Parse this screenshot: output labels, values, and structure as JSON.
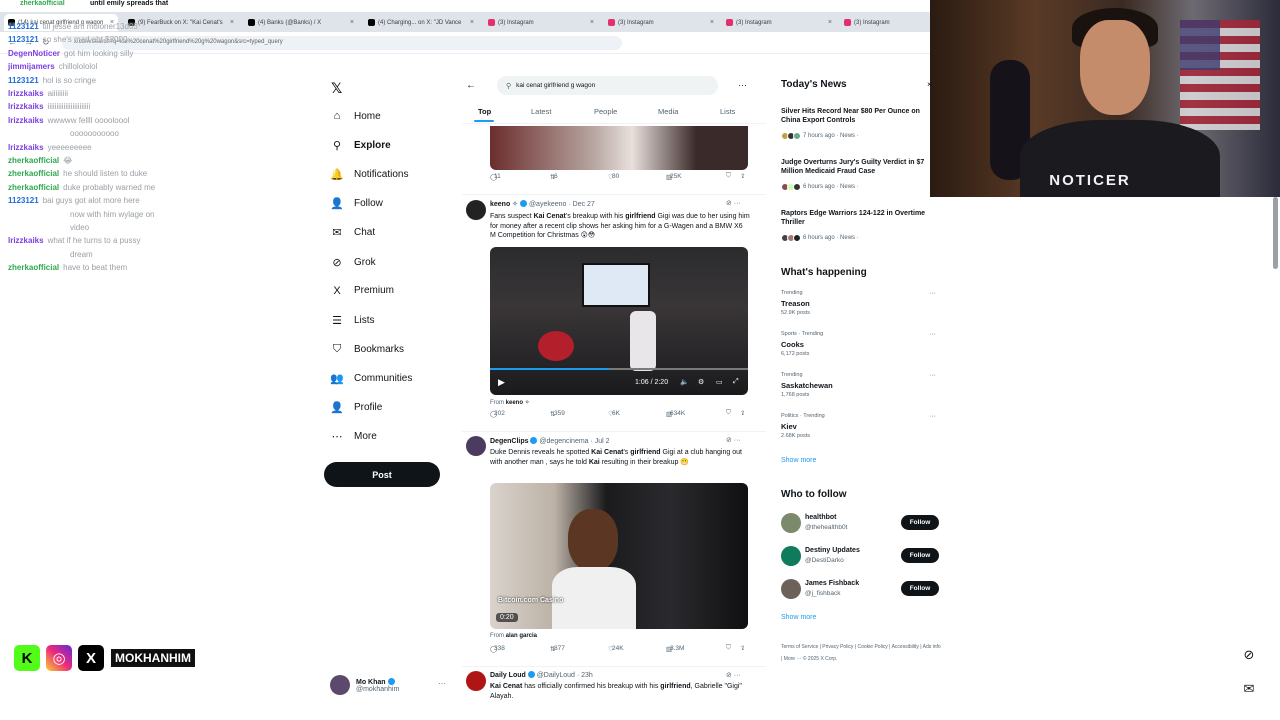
{
  "stream_title": "until emily spreads that",
  "stream_username": "zherkaofficial",
  "browser": {
    "tabs": [
      {
        "label": "(14) kai cenat girlfriend g wagon",
        "icon": "x-icon",
        "active": true
      },
      {
        "label": "(9) FearBuck on X: \"Kai Cenat's",
        "icon": "x-icon"
      },
      {
        "label": "(4) Banks (@Banks) / X",
        "icon": "x-icon"
      },
      {
        "label": "(4) Charging... on X: \"JD Vance",
        "icon": "x-icon"
      },
      {
        "label": "(3) Instagram",
        "icon": "instagram-icon"
      },
      {
        "label": "(3) Instagram",
        "icon": "instagram-icon"
      },
      {
        "label": "(3) Instagram",
        "icon": "instagram-icon"
      },
      {
        "label": "(3) Instagram",
        "icon": "instagram-icon"
      }
    ],
    "url": "x.com/search?q=kai%20cenat%20girlfriend%20g%20wagon&src=typed_query"
  },
  "chat": [
    {
      "user": "1123121",
      "color": "#1e6fd9",
      "msg": "till jesse am moloner13d03"
    },
    {
      "user": "1123121",
      "color": "#1e6fd9",
      "msg": "so she's mad abt $2000"
    },
    {
      "user": "DegenNoticer",
      "color": "#7b3fe4",
      "msg": "got him looking silly"
    },
    {
      "user": "jimmijamers",
      "color": "#7b3fe4",
      "msg": "chillolololol"
    },
    {
      "user": "1123121",
      "color": "#1e6fd9",
      "msg": "hol is so cringe"
    },
    {
      "user": "lrizzkaiks",
      "color": "#7b3fe4",
      "msg": "aiiiiiiiii"
    },
    {
      "user": "lrizzkaiks",
      "color": "#7b3fe4",
      "msg": "iiiiiiiiiiiiiiiiiiiiiiii"
    },
    {
      "user": "lrizzkaiks",
      "color": "#7b3fe4",
      "msg": "wwwww fellll ooooloool"
    },
    {
      "user": "",
      "color": "#7b3fe4",
      "msg": "ooooooooooo"
    },
    {
      "user": "lrizzkaiks",
      "color": "#7b3fe4",
      "msg": "yeeeeeeeee"
    },
    {
      "user": "zherkaofficial",
      "color": "#2fa84f",
      "msg": "😂"
    },
    {
      "user": "zherkaofficial",
      "color": "#2fa84f",
      "msg": "he should listen to duke"
    },
    {
      "user": "zherkaofficial",
      "color": "#2fa84f",
      "msg": "duke probably warned me"
    },
    {
      "user": "1123121",
      "color": "#1e6fd9",
      "msg": "bai guys got alot more here"
    },
    {
      "user": "",
      "color": "#1e6fd9",
      "msg": "now with him wylage on"
    },
    {
      "user": "",
      "color": "#1e6fd9",
      "msg": "video"
    },
    {
      "user": "lrizzkaiks",
      "color": "#7b3fe4",
      "msg": "what if he turns to a pussy"
    },
    {
      "user": "",
      "color": "#7b3fe4",
      "msg": "dream"
    },
    {
      "user": "zherkaofficial",
      "color": "#2fa84f",
      "msg": "have to beat them"
    }
  ],
  "socials": {
    "handle": "MOKHANHIM"
  },
  "webcam": {
    "shirt_text": "NOTICER"
  },
  "x_nav": {
    "items": [
      {
        "label": "Home",
        "icon": "home-icon",
        "glyph": "⌂"
      },
      {
        "label": "Explore",
        "icon": "search-icon",
        "glyph": "⚲",
        "bold": true
      },
      {
        "label": "Notifications",
        "icon": "bell-icon",
        "glyph": "🔔"
      },
      {
        "label": "Follow",
        "icon": "person-add-icon",
        "glyph": "👤"
      },
      {
        "label": "Chat",
        "icon": "chat-icon",
        "glyph": "✉"
      },
      {
        "label": "Grok",
        "icon": "grok-icon",
        "glyph": "⊘"
      },
      {
        "label": "Premium",
        "icon": "x-premium-icon",
        "glyph": "X"
      },
      {
        "label": "Lists",
        "icon": "list-icon",
        "glyph": "☰"
      },
      {
        "label": "Bookmarks",
        "icon": "bookmark-icon",
        "glyph": "⛉"
      },
      {
        "label": "Communities",
        "icon": "communities-icon",
        "glyph": "👥"
      },
      {
        "label": "Profile",
        "icon": "profile-icon",
        "glyph": "👤"
      },
      {
        "label": "More",
        "icon": "more-icon",
        "glyph": "⋯"
      }
    ],
    "post_label": "Post",
    "account": {
      "name": "Mo Khan",
      "handle": "@mokhanhim"
    }
  },
  "search": {
    "query": "kai cenat girlfriend g wagon",
    "tabs": [
      "Top",
      "Latest",
      "People",
      "Media",
      "Lists"
    ],
    "active_tab": "Top"
  },
  "posts": [
    {
      "stats": {
        "replies": "11",
        "reposts": "6",
        "likes": "80",
        "views": "25K"
      }
    },
    {
      "name": "keeno ✧",
      "handle": "@ayekeeno · Dec 27",
      "text_parts": [
        "Fans suspect ",
        "Kai Cenat",
        "'s breakup with his ",
        "girlfriend",
        " Gigi was due to her using him for money after a recent clip shows her asking him for a G-Wagen and a BMW X6 M Competition for Christmas 😲😳"
      ],
      "video_time": "1:06 / 2:20",
      "from_label": "From",
      "from": "keeno ✧",
      "stats": {
        "replies": "202",
        "reposts": "359",
        "likes": "6K",
        "views": "634K"
      }
    },
    {
      "name": "DegenClips",
      "handle": "@degencinema · Jul 2",
      "text_parts": [
        "Duke Dennis reveals he spotted ",
        "Kai Cenat",
        "'s ",
        "girlfriend",
        " Gigi at a club hanging out with another man , says he told ",
        "Kai",
        " resulting in their breakup 😬"
      ],
      "video_time": "0:20",
      "watermark": "Bitcoin.com Casino",
      "from_label": "From",
      "from": "alan garcia",
      "stats": {
        "replies": "338",
        "reposts": "877",
        "likes": "24K",
        "views": "3.3M"
      }
    },
    {
      "name": "Daily Loud",
      "handle": "@DailyLoud · 23h",
      "text_parts": [
        "Kai Cenat",
        " has officially confirmed his breakup with his ",
        "girlfriend",
        ", Gabrielle \"Gigi\" Alayah."
      ]
    }
  ],
  "today_news": {
    "title": "Today's News",
    "items": [
      {
        "title": "Silver Hits Record Near $80 Per Ounce on China Export Controls",
        "meta": "7 hours ago · News ·"
      },
      {
        "title": "Judge Overturns Jury's Guilty Verdict in $7 Million Medicaid Fraud Case",
        "meta": "6 hours ago · News ·"
      },
      {
        "title": "Raptors Edge Warriors 124-122 in Overtime Thriller",
        "meta": "6 hours ago · News ·"
      }
    ]
  },
  "happening": {
    "title": "What's happening",
    "items": [
      {
        "context": "Trending",
        "name": "Treason",
        "posts": "52.9K posts"
      },
      {
        "context": "Sports · Trending",
        "name": "Cooks",
        "posts": "6,172 posts"
      },
      {
        "context": "Trending",
        "name": "Saskatchewan",
        "posts": "1,768 posts"
      },
      {
        "context": "Politics · Trending",
        "name": "Kiev",
        "posts": "2.68K posts"
      }
    ],
    "show_more": "Show more"
  },
  "who_to_follow": {
    "title": "Who to follow",
    "items": [
      {
        "name": "healthbot",
        "handle": "@thehealthb0t",
        "color": "#7a8a6a"
      },
      {
        "name": "Destiny Updates",
        "handle": "@DestiDarko",
        "color": "#0e7b5c"
      },
      {
        "name": "James Fishback",
        "handle": "@j_fishback",
        "color": "#6d6259"
      }
    ],
    "follow_label": "Follow",
    "show_more": "Show more"
  },
  "footer": "Terms of Service | Privacy Policy | Cookie Policy | Accessibility | Ads info | More ··· © 2025 X Corp.",
  "colors": {
    "accent": "#1d9bf0",
    "text": "#0f1419",
    "muted": "#536471"
  }
}
